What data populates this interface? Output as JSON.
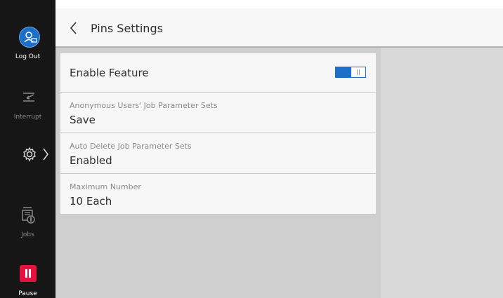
{
  "sidebar": {
    "logout_label": "Log Out",
    "interrupt_label": "Interrupt",
    "jobs_label": "Jobs",
    "pause_label": "Pause"
  },
  "header": {
    "title": "Pins Settings"
  },
  "settings": {
    "enable_feature": {
      "label": "Enable Feature",
      "on": true
    },
    "rows": [
      {
        "label": "Anonymous Users' Job Parameter Sets",
        "value": "Save"
      },
      {
        "label": "Auto Delete Job Parameter Sets",
        "value": "Enabled"
      },
      {
        "label": "Maximum Number",
        "value": "10 Each"
      }
    ]
  },
  "colors": {
    "accent": "#1b6fc9",
    "pause": "#e5133f",
    "rail": "#161616"
  },
  "icons": [
    "logout-icon",
    "interrupt-icon",
    "gear-icon",
    "chevron-right-icon",
    "jobs-icon",
    "pause-icon",
    "chevron-left-icon"
  ]
}
